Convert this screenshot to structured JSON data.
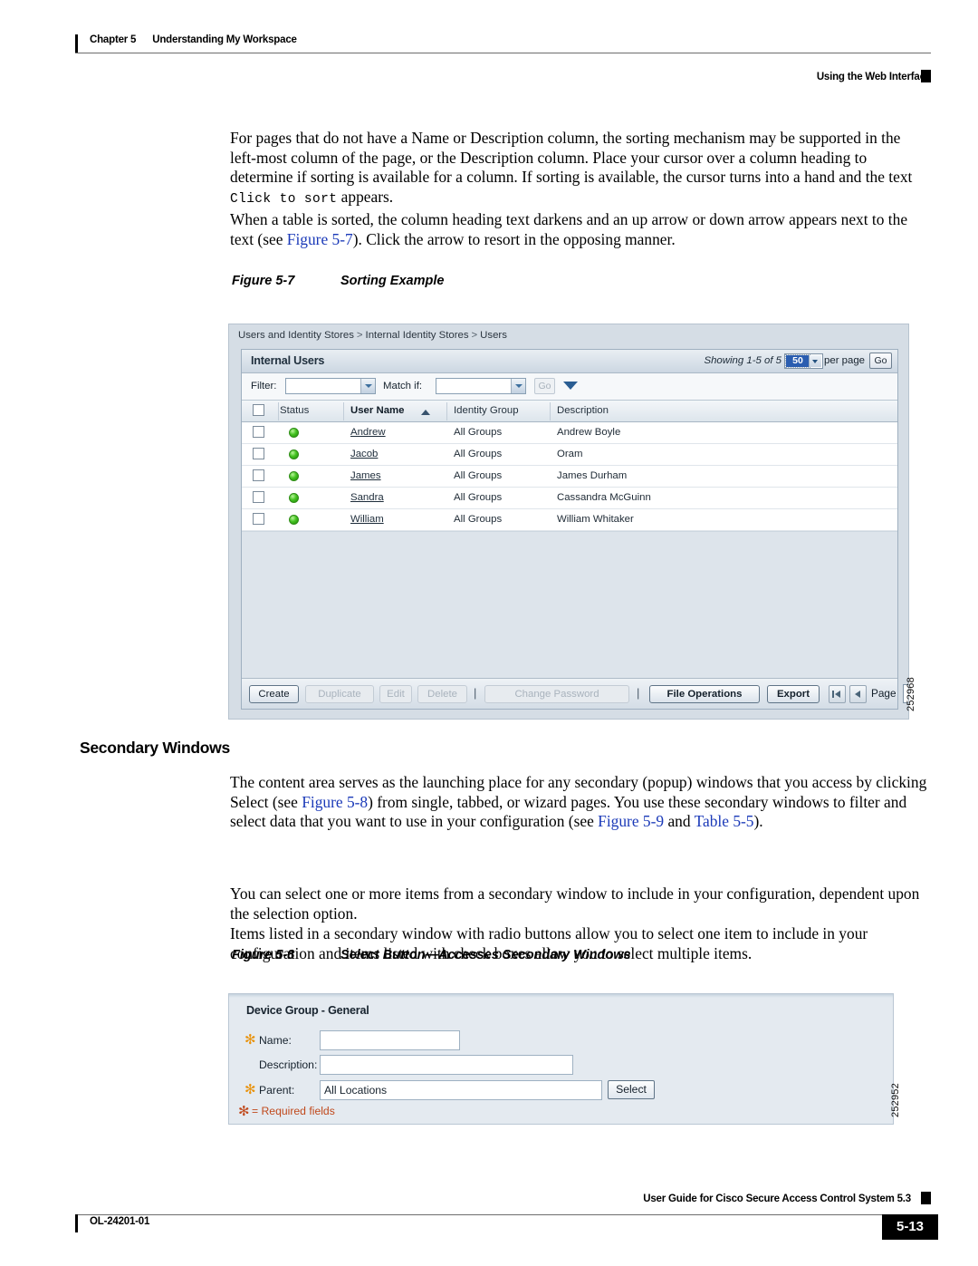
{
  "header": {
    "chapter_label": "Chapter 5",
    "chapter_title": "Understanding My Workspace",
    "recto_title": "Using the Web Interface"
  },
  "body": {
    "para1_a": "For pages that do not have a Name or Description column, the sorting mechanism may be supported in the left-most column of the page, or the Description column. Place your cursor over a column heading to determine if sorting is available for a column. If sorting is available, the cursor turns into a hand and the text ",
    "para1_mono": "Click to sort",
    "para1_b": " appears.",
    "para2_a": "When a table is sorted, the column heading text darkens and an up arrow or down arrow appears next to the text (see ",
    "para2_xref": "Figure 5-7",
    "para2_b": "). Click the arrow to resort in the opposing manner.",
    "section_heading": "Secondary Windows",
    "para3_a": "The content area serves as the launching place for any secondary (popup) windows that you access by clicking Select (see ",
    "para3_xref1": "Figure 5-8",
    "para3_b": ") from single, tabbed, or wizard pages. You use these secondary windows to filter and select data that you want to use in your configuration (see ",
    "para3_xref2": "Figure 5-9",
    "para3_c": " and ",
    "para3_xref3": "Table 5-5",
    "para3_d": ").",
    "para4": "You can select one or more items from a secondary window to include in your configuration, dependent upon the selection option.",
    "para5": "Items listed in a secondary window with radio buttons allow you to select one item to include in your configuration and items listed with check boxes allow you to select multiple items."
  },
  "figure7": {
    "caption_label": "Figure 5-7",
    "caption_title": "Sorting Example",
    "figure_id": "252968",
    "breadcrumb": [
      "Users and Identity Stores",
      "Internal Identity Stores",
      "Users"
    ],
    "breadcrumb_separator": ">",
    "panel_title": "Internal Users",
    "showing_text": "Showing 1-5 of 5",
    "per_page_value": "50",
    "per_page_label": "per page",
    "go_label": "Go",
    "filter_label": "Filter:",
    "filter_value": "",
    "match_label": "Match if:",
    "match_value": "",
    "filter_go_label": "Go",
    "columns": [
      "",
      "Status",
      "User Name",
      "Identity Group",
      "Description"
    ],
    "sort_column": "User Name",
    "sort_direction": "asc",
    "rows": [
      {
        "status": "enabled",
        "user_name": "Andrew",
        "identity_group": "All Groups",
        "description": "Andrew Boyle"
      },
      {
        "status": "enabled",
        "user_name": "Jacob",
        "identity_group": "All Groups",
        "description": "Oram"
      },
      {
        "status": "enabled",
        "user_name": "James",
        "identity_group": "All Groups",
        "description": "James Durham"
      },
      {
        "status": "enabled",
        "user_name": "Sandra",
        "identity_group": "All Groups",
        "description": "Cassandra McGuinn"
      },
      {
        "status": "enabled",
        "user_name": "William",
        "identity_group": "All Groups",
        "description": "William Whitaker"
      }
    ],
    "buttons": {
      "create": "Create",
      "duplicate": "Duplicate",
      "edit": "Edit",
      "delete": "Delete",
      "change_password": "Change Password",
      "file_operations": "File Operations",
      "export": "Export",
      "page_label": "Page",
      "page_value": ""
    },
    "separator": "|"
  },
  "figure8": {
    "caption_label": "Figure 5-8",
    "caption_title": "Select Button—Accesses Secondary Windows",
    "figure_id": "252952",
    "form_title": "Device Group - General",
    "name_label": "Name:",
    "name_value": "",
    "description_label": "Description:",
    "description_value": "",
    "parent_label": "Parent:",
    "parent_value": "All Locations",
    "select_button": "Select",
    "required_note": "= Required fields",
    "required_marker": "✻",
    "required_color": "#e8920c",
    "note_color": "#c0491c"
  },
  "footer": {
    "doc_id": "OL-24201-01",
    "guide_title": "User Guide for Cisco Secure Access Control System 5.3",
    "page_number": "5-13"
  }
}
